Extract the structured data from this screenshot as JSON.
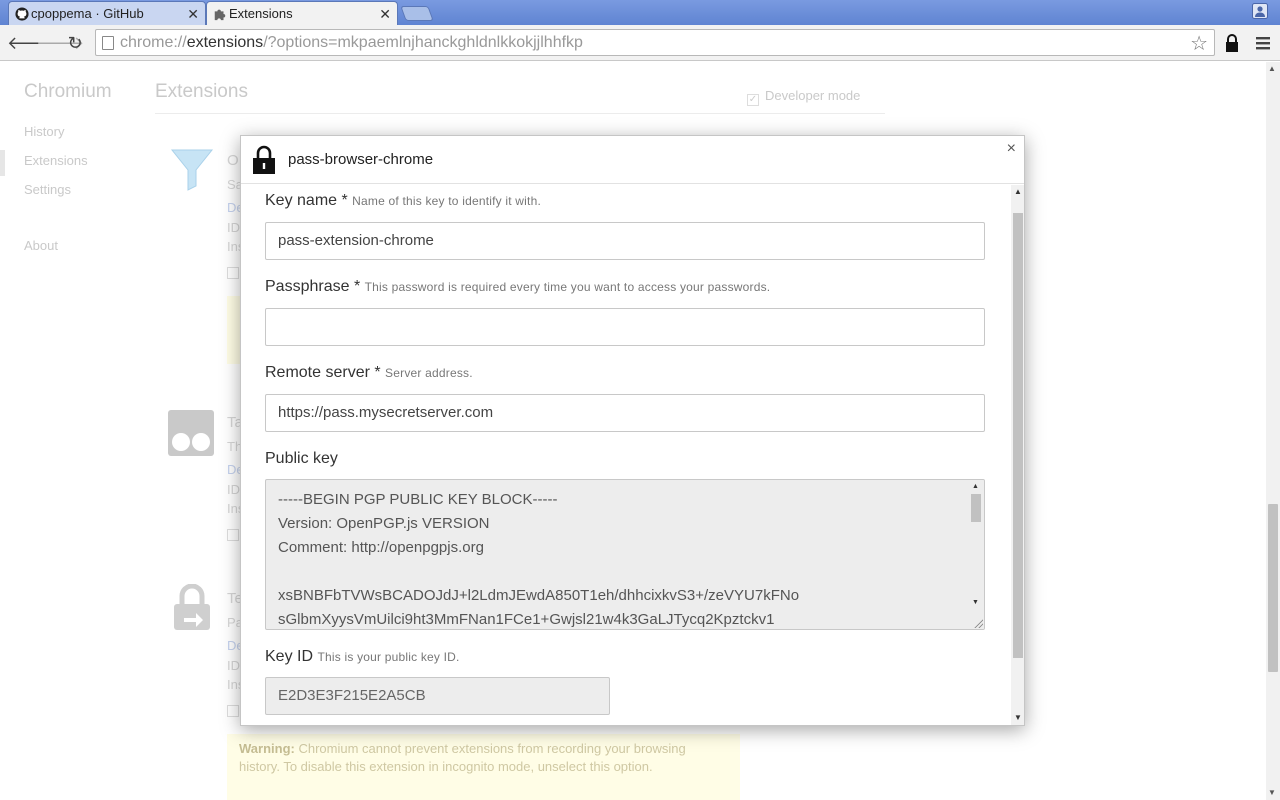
{
  "tabs": [
    {
      "title": "cpoppema · GitHub",
      "icon": "github-icon"
    },
    {
      "title": "Extensions",
      "icon": "puzzle-icon"
    }
  ],
  "toolbar": {
    "url_scheme": "chrome://",
    "url_host": "extensions",
    "url_rest": "/?options=mkpaemlnjhanckghldnlkkokjjlhhfkp"
  },
  "background": {
    "brand": "Chromium",
    "page_title": "Extensions",
    "developer_mode_label": "Developer mode",
    "nav": [
      "History",
      "Extensions",
      "Settings",
      "About"
    ],
    "warning_bold": "Warning:",
    "warning_text": " Chromium cannot prevent extensions from recording your browsing history. To disable this extension in incognito mode, unselect this option.",
    "fragments": {
      "ext1_title": "O",
      "ext1_sub": "Sa",
      "ext2_title": "Ta",
      "ext2_sub": "Th",
      "ext3_title": "Te",
      "ext3_sub": "Pa",
      "details": "De",
      "id": "ID",
      "inspect": "Ins"
    }
  },
  "modal": {
    "title": "pass-browser-chrome",
    "close": "×",
    "key_name": {
      "label": "Key name *",
      "hint": "Name of this key to identify it with.",
      "value": "pass-extension-chrome"
    },
    "passphrase": {
      "label": "Passphrase *",
      "hint": "This password is required every time you want to access your passwords.",
      "value": ""
    },
    "remote_server": {
      "label": "Remote server *",
      "hint": "Server address.",
      "value": "https://pass.mysecretserver.com"
    },
    "public_key": {
      "label": "Public key",
      "value": "-----BEGIN PGP PUBLIC KEY BLOCK-----\nVersion: OpenPGP.js VERSION\nComment: http://openpgpjs.org\n\nxsBNBFbTVWsBCADOJdJ+l2LdmJEwdA850T1eh/dhhcixkvS3+/zeVYU7kFNo\nsGlbmXyysVmUilci9ht3MmFNan1FCe1+Gwjsl21w4k3GaLJTycq2Kpztckv1"
    },
    "key_id": {
      "label": "Key ID",
      "hint": "This is your public key ID.",
      "value": "E2D3E3F215E2A5CB"
    }
  }
}
